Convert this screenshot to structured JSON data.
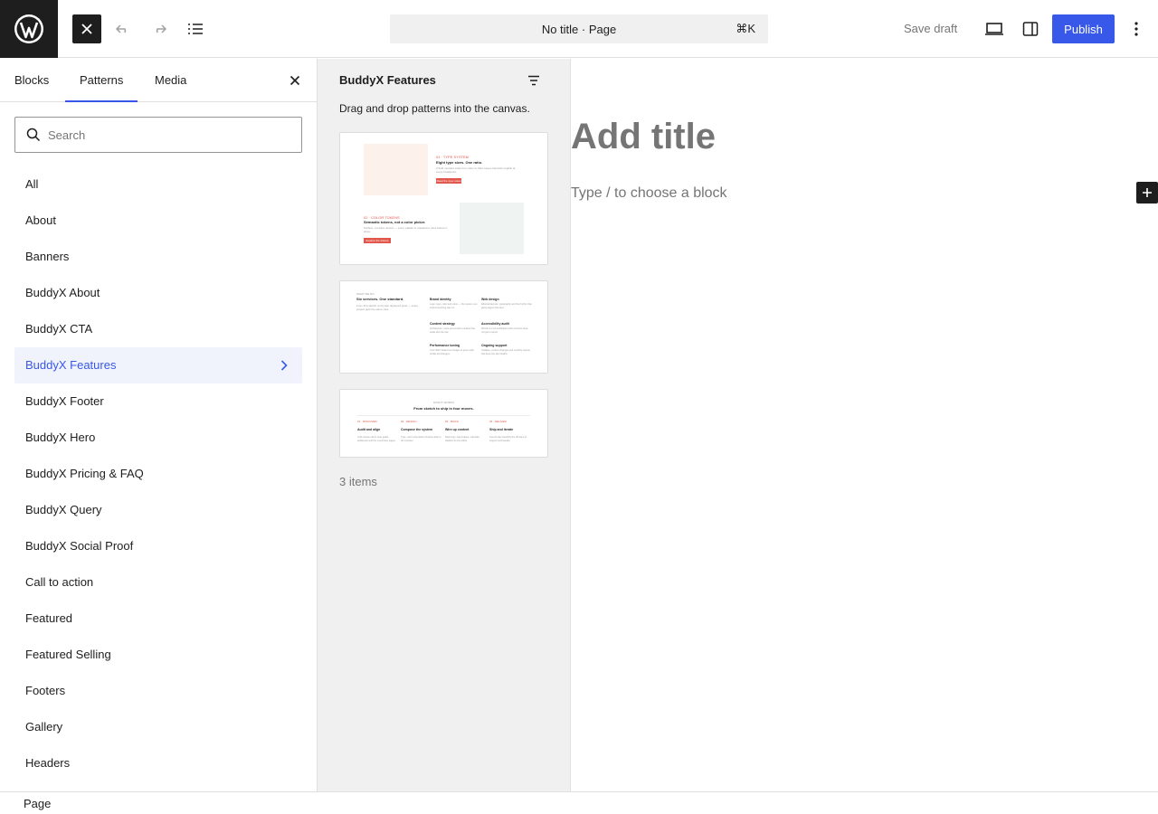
{
  "topbar": {
    "logo_icon": "wordpress-logo-icon",
    "close_icon": "close-icon",
    "undo_icon": "undo-icon",
    "redo_icon": "redo-icon",
    "list_view_icon": "list-view-icon",
    "command_label": "No title · Page",
    "command_shortcut": "⌘K",
    "save_draft": "Save draft",
    "view_icon": "desktop-view-icon",
    "settings_icon": "sidebar-settings-icon",
    "publish": "Publish",
    "options_icon": "more-options-icon",
    "accent": "#3858e9"
  },
  "inserter": {
    "tabs": [
      "Blocks",
      "Patterns",
      "Media"
    ],
    "active_tab": "Patterns",
    "search_placeholder": "Search",
    "categories": [
      "All",
      "About",
      "Banners",
      "BuddyX About",
      "BuddyX CTA",
      "BuddyX Features",
      "BuddyX Footer",
      "BuddyX Hero",
      "BuddyX Pricing & FAQ",
      "BuddyX Query",
      "BuddyX Social Proof",
      "Call to action",
      "Featured",
      "Featured Selling",
      "Footers",
      "Gallery",
      "Headers"
    ],
    "active_category": "BuddyX Features"
  },
  "patterns": {
    "title": "BuddyX Features",
    "description": "Drag and drop patterns into the canvas.",
    "count": "3 items",
    "card1": {
      "kicker_a": "01 · TYPE SYSTEM",
      "head_a": "Eight type sizes. One ratio.",
      "body_a": "A fluid modular scale from 12px to 64px keeps hierarchy legible at every breakpoint.",
      "btn_a": "Read the type notes",
      "kicker_b": "02 · COLOR TOKENS",
      "head_b": "Semantic tokens, not a color picker.",
      "body_b": "Surface, contrast, accent — every palette is mapped to roles before it ships.",
      "btn_b": "Explore the tokens"
    },
    "card2": {
      "kicker": "WHAT WE DO",
      "head": "Six services. One standard.",
      "body": "From first sketch to the last deployed pixel — every project gets the same care.",
      "items": [
        {
          "t": "Brand identity",
          "d": "Logo, type, color and voice — the system you build everything else on."
        },
        {
          "t": "Web design",
          "d": "Editorial layouts, typography and the rhythm that gives pages their feel."
        },
        {
          "t": "Content strategy",
          "d": "Architecture, voice and content models that scale with the site."
        },
        {
          "t": "Accessibility audit",
          "d": "WCAG 2.2 AA verification with concrete fixes, not just a report."
        },
        {
          "t": "Performance tuning",
          "d": "Core Web Vitals from budget to green with profile-led changes."
        },
        {
          "t": "Ongoing support",
          "d": "Updates, content changes and monthly reports that keep the site healthy."
        }
      ]
    },
    "card3": {
      "kicker": "HOW IT WORKS",
      "head": "From sketch to ship in four moves.",
      "steps": [
        {
          "k": "01 · DISCOVER",
          "t": "Audit and align",
          "d": "A 90-minute call to map goals, audiences and the must-have pages."
        },
        {
          "k": "02 · DESIGN",
          "t": "Compose the system",
          "d": "Type, color and pattern choices built in the browser."
        },
        {
          "k": "03 · BUILD",
          "t": "Wire up content",
          "d": "Real copy, real images, real data loaded into the editor."
        },
        {
          "k": "04 · DELIVER",
          "t": "Ship and iterate",
          "d": "Launch day handoff plus 30 days of support and tweaks."
        }
      ]
    }
  },
  "canvas": {
    "title_placeholder": "Add title",
    "block_placeholder": "Type / to choose a block",
    "add_block_icon": "plus-icon"
  },
  "footer": {
    "breadcrumb": "Page"
  }
}
